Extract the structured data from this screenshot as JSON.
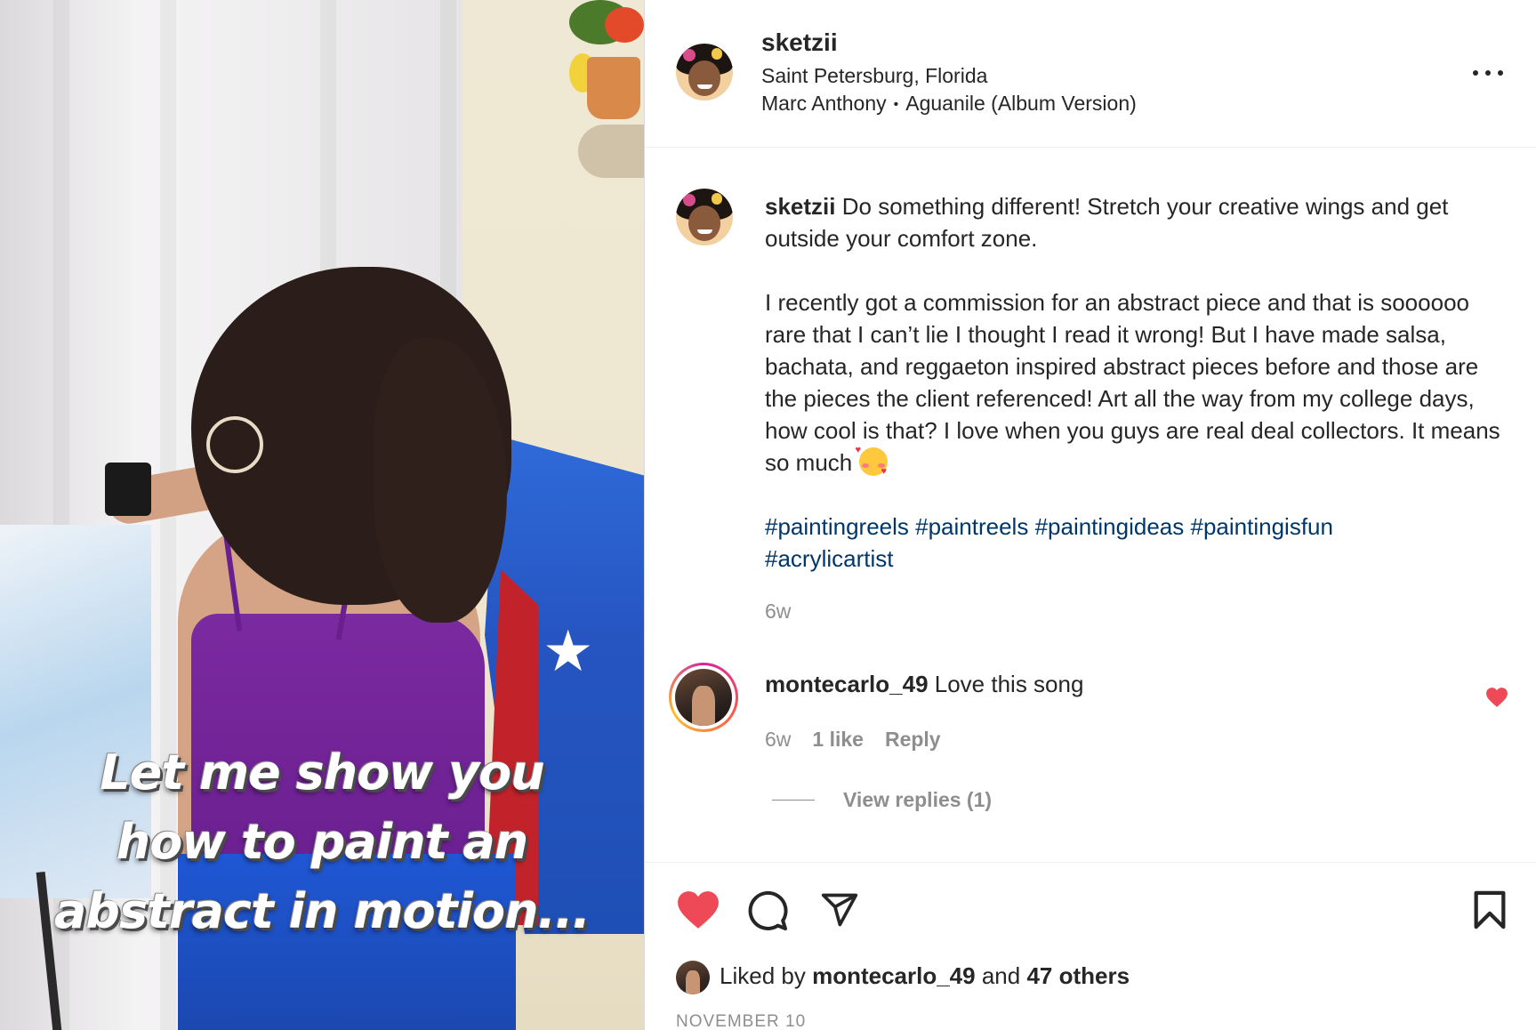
{
  "media": {
    "overlay_lines": [
      "Let me show you",
      "how to paint an",
      "abstract in motion..."
    ]
  },
  "header": {
    "username": "sketzii",
    "location": "Saint Petersburg, Florida",
    "music_artist": "Marc Anthony",
    "music_separator": "•",
    "music_track": "Aguanile (Album Version)",
    "more_icon": "more-horizontal-icon"
  },
  "caption": {
    "username": "sketzii",
    "intro": "Do something different! Stretch your creative wings and get outside your comfort zone.",
    "body": "I recently got a commission for an abstract piece and that is soooooo rare that I can’t lie I thought I read it wrong! But I have made salsa, bachata, and reggaeton inspired abstract pieces before and those are the pieces the client referenced! Art all the way from my college days, how cool is that? I love when you guys are real deal collectors. It means so much",
    "emoji": "smiling-face-with-hearts-emoji",
    "hashtags": [
      "#paintingreels",
      "#paintreels",
      "#paintingideas",
      "#paintingisfun",
      "#acrylicartist"
    ],
    "time_ago": "6w"
  },
  "comment": {
    "username": "montecarlo_49",
    "text": "Love this song",
    "time_ago": "6w",
    "likes": "1 like",
    "reply_label": "Reply",
    "view_replies": "View replies (1)",
    "liked": true
  },
  "actions": {
    "liked": true,
    "like_icon": "heart-filled-icon",
    "comment_icon": "comment-icon",
    "share_icon": "paper-plane-icon",
    "save_icon": "bookmark-icon",
    "liked_by_prefix": "Liked by",
    "liked_by_user": "montecarlo_49",
    "liked_by_and": "and",
    "liked_by_others": "47 others",
    "date": "NOVEMBER 10"
  },
  "colors": {
    "like_red": "#ed4956",
    "hashtag_blue": "#00376b",
    "muted_gray": "#8e8e8e",
    "text": "#262626"
  }
}
